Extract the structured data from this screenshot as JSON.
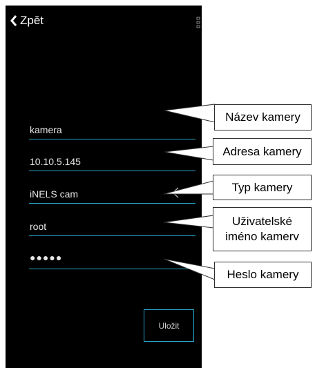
{
  "header": {
    "back_label": "Zpět"
  },
  "form": {
    "camera_name": "kamera",
    "camera_address": "10.10.5.145",
    "camera_type": "iNELS cam",
    "username": "root",
    "password": "●●●●●"
  },
  "save_label": "Uložit",
  "callouts": {
    "name": "Název kamery",
    "address": "Adresa kamery",
    "type": "Typ kamery",
    "username_line1": "Uživatelské",
    "username_line2": "iméno kamerv",
    "password": "Heslo kamery"
  },
  "colors": {
    "accent": "#2aa7cf",
    "background": "#000000"
  }
}
